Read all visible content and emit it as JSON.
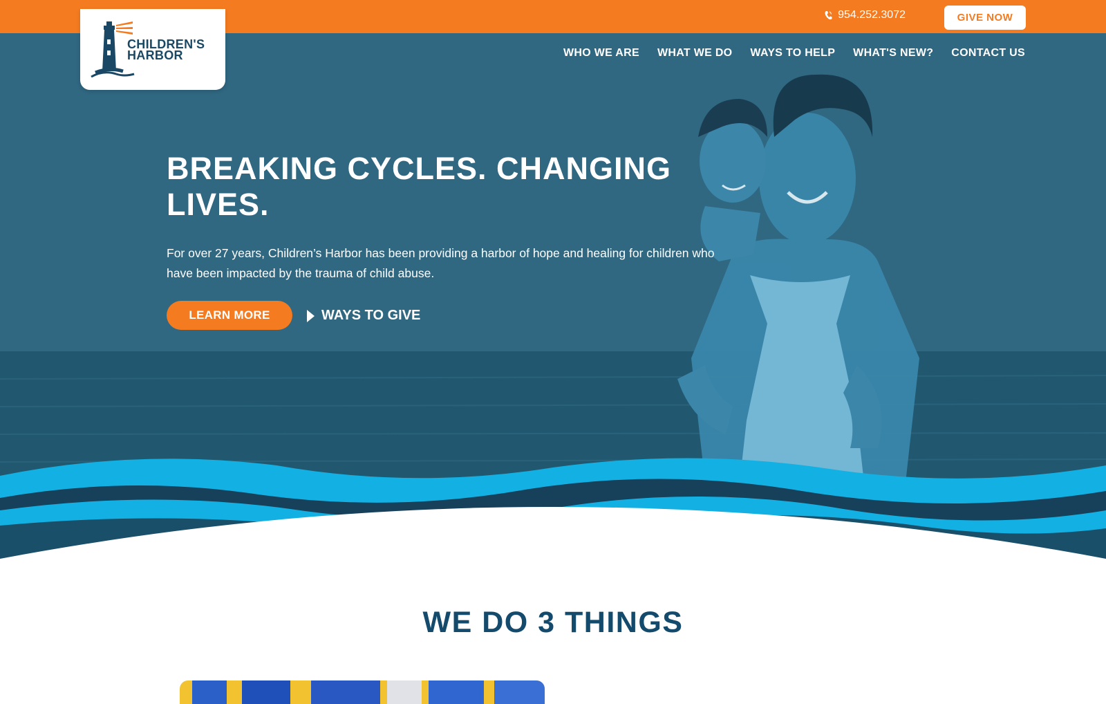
{
  "topbar": {
    "phone": "954.252.3072",
    "phone_icon": "phone-icon",
    "give_label": "GIVE NOW",
    "accent": "#f47b20"
  },
  "logo": {
    "line1": "CHILDREN'S",
    "line2": "HARBOR",
    "icon": "lighthouse-icon"
  },
  "nav": {
    "items": [
      "WHO WE ARE",
      "WHAT WE DO",
      "WAYS TO HELP",
      "WHAT'S NEW?",
      "CONTACT US"
    ]
  },
  "hero": {
    "headline_line1": "BREAKING CYCLES. CHANGING",
    "headline_line2": "LIVES.",
    "subtext_line1": "For over 27 years, Children’s Harbor has been providing a harbor of hope and healing for children who",
    "subtext_line2": "have been impacted by the trauma of child abuse.",
    "cta_primary": "LEARN MORE",
    "cta_secondary": "WAYS TO GIVE",
    "overlay_color": "#306781",
    "wave_color": "#13b1e3"
  },
  "section": {
    "title": "WE DO 3 THINGS",
    "title_color": "#144a6b"
  }
}
